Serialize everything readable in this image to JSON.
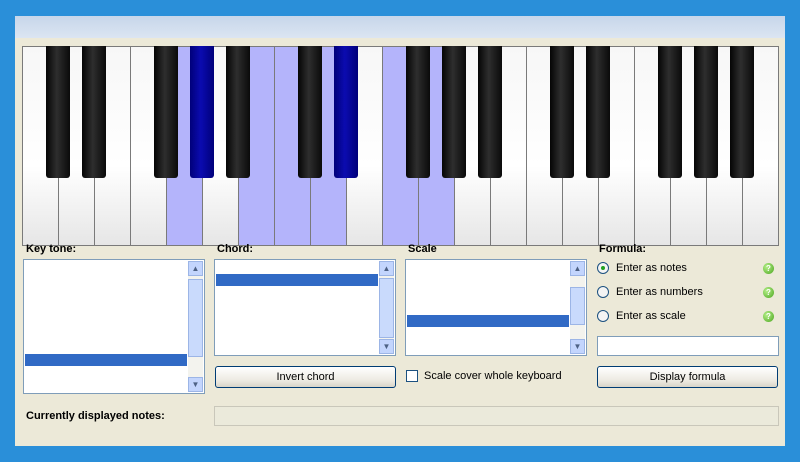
{
  "keyboard": {
    "white_key_count": 21,
    "highlighted_white_keys": [
      4,
      6,
      7,
      8,
      10,
      11
    ],
    "highlighted_black_keys": [
      3,
      6
    ],
    "highlight_color": "#b4b4fb",
    "active_black_color": "#0b0bb0"
  },
  "key_tone": {
    "label": "Key tone:"
  },
  "chord": {
    "label": "Chord:",
    "invert_label": "Invert chord"
  },
  "scale": {
    "label": "Scale",
    "cover_label": "Scale cover whole keyboard"
  },
  "formula": {
    "label": "Formula:",
    "options": [
      "Enter as notes",
      "Enter as numbers",
      "Enter as scale"
    ],
    "selected_index": 0,
    "display_label": "Display formula",
    "help_icon": "help-icon"
  },
  "currently_displayed": {
    "label": "Currently displayed notes:"
  },
  "colors": {
    "selection": "#316ac5",
    "background": "#ece9d8",
    "frame": "#2a8fd9"
  }
}
